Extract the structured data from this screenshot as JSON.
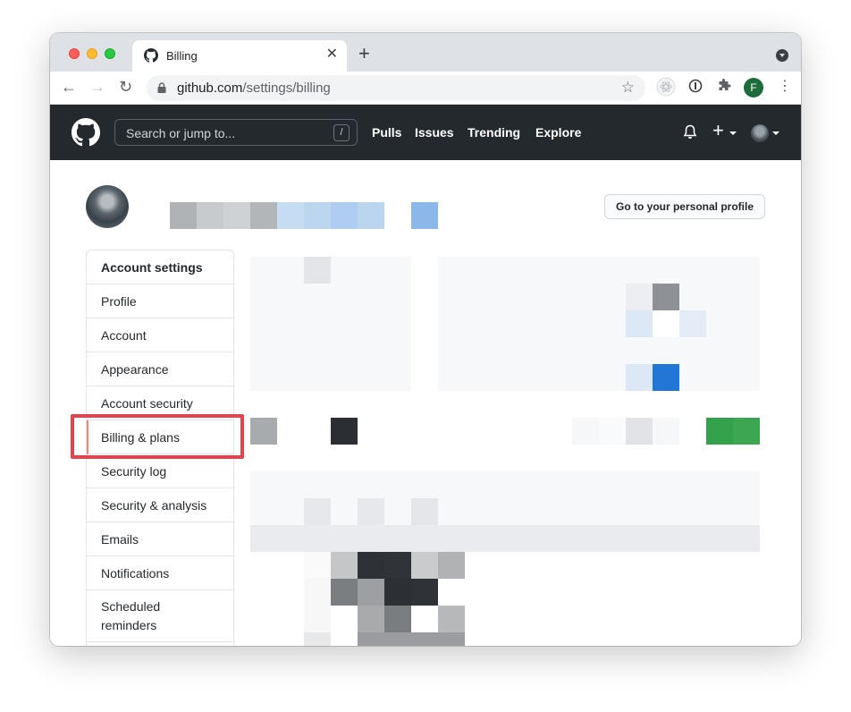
{
  "browser": {
    "tab_title": "Billing",
    "url_host": "github.com",
    "url_path": "/settings/billing",
    "profile_initial": "F"
  },
  "github": {
    "search_placeholder": "Search or jump to...",
    "search_shortcut": "/",
    "nav": [
      "Pulls",
      "Issues",
      "Trending",
      "Explore"
    ],
    "plus": "+"
  },
  "page": {
    "personal_profile_button": "Go to your personal profile",
    "menu_header": "Account settings",
    "menu_items": [
      "Profile",
      "Account",
      "Appearance",
      "Account security",
      "Billing & plans",
      "Security log",
      "Security & analysis",
      "Emails",
      "Notifications",
      "Scheduled reminders"
    ],
    "selected_item": "Billing & plans"
  },
  "colors": {
    "header_bg": "#24292e",
    "highlight": "#e8404c",
    "selected_indicator": "#f9826c"
  }
}
